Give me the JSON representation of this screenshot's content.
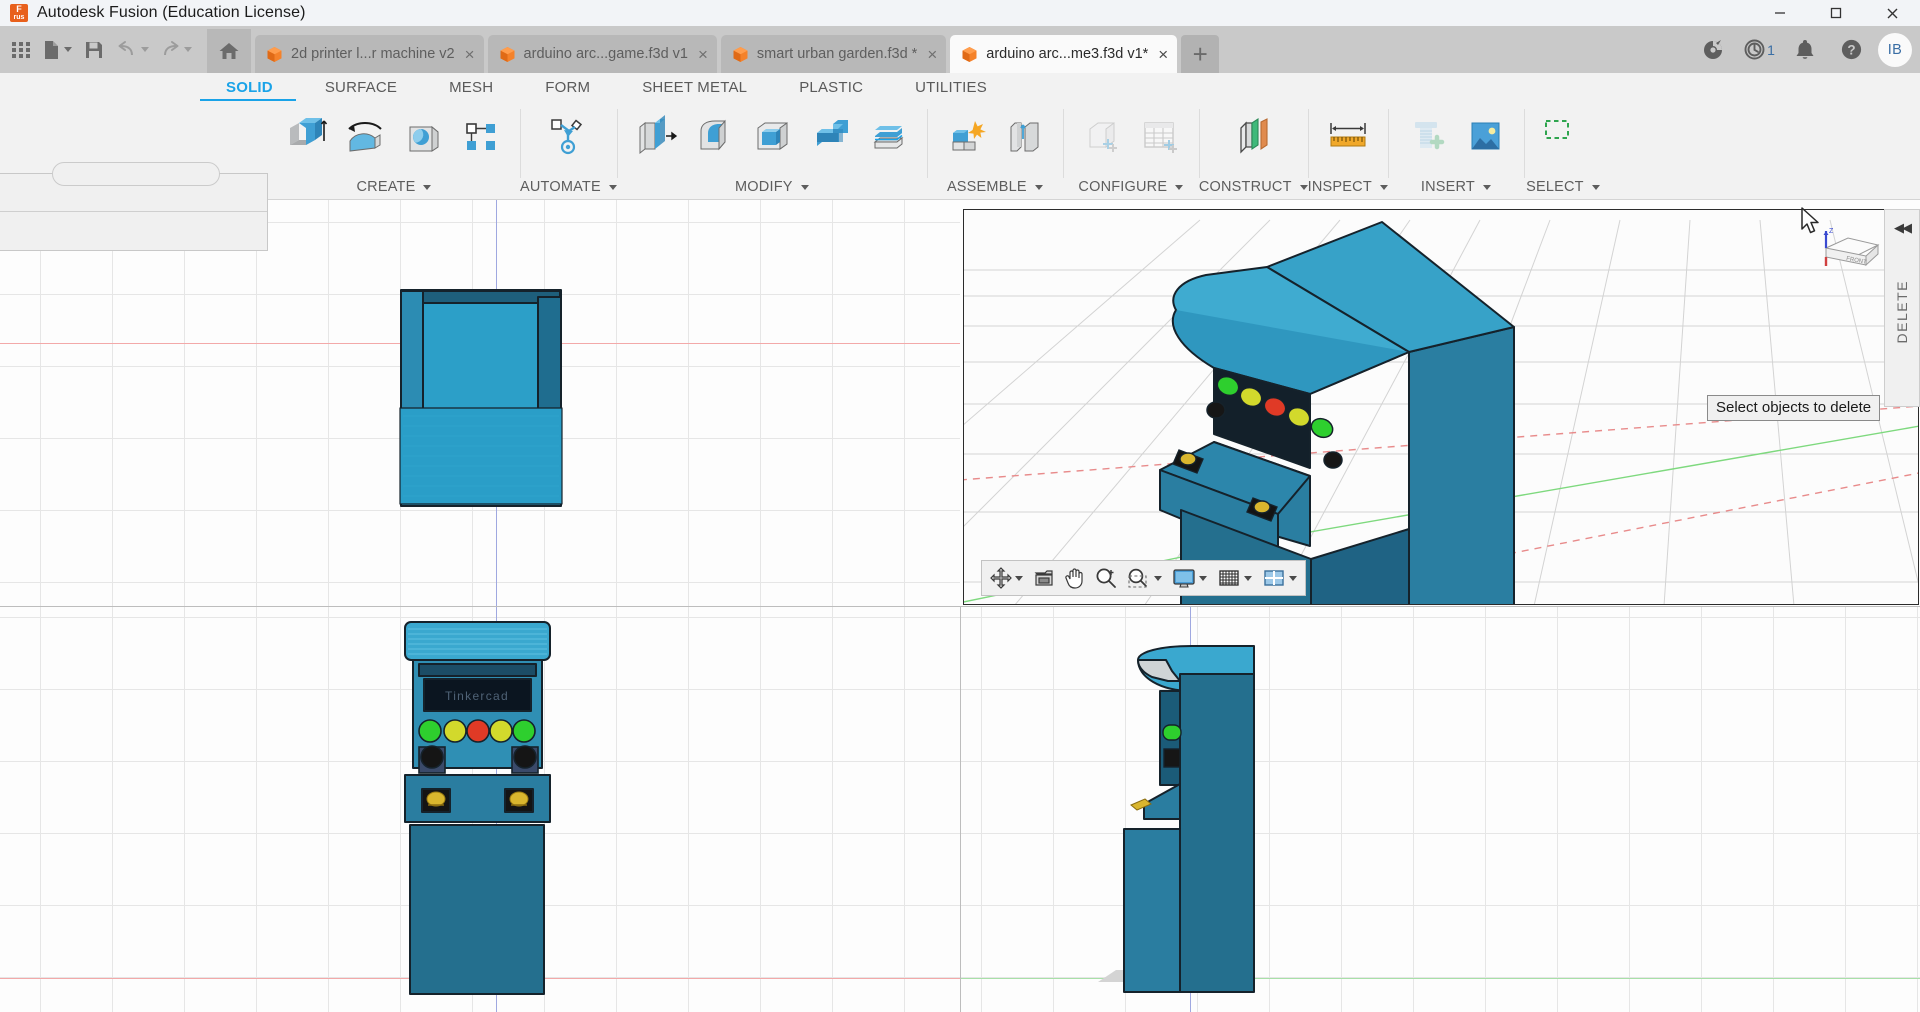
{
  "window": {
    "title": "Autodesk Fusion (Education License)",
    "logo_text": "F",
    "logo_sub": "rus",
    "minimize_icon": "minimize-icon",
    "maximize_icon": "maximize-icon",
    "close_icon": "close-icon"
  },
  "quick_access": {
    "grid_icon": "app-grid-icon",
    "new_icon": "new-document-icon",
    "save_icon": "save-icon",
    "undo_icon": "undo-icon",
    "redo_icon": "redo-icon",
    "home_icon": "home-icon"
  },
  "tabs": [
    {
      "label": "2d printer l...r machine v2",
      "active": false,
      "icon": "file-cube-icon",
      "close": "×"
    },
    {
      "label": "arduino arc...game.f3d v1",
      "active": false,
      "icon": "file-cube-icon",
      "close": "×"
    },
    {
      "label": "smart urban garden.f3d *",
      "active": false,
      "icon": "file-cube-icon",
      "close": "×"
    },
    {
      "label": "arduino arc...me3.f3d v1*",
      "active": true,
      "icon": "file-cube-icon",
      "close": "×"
    }
  ],
  "tab_actions": {
    "new_tab_label": "+",
    "extensions_icon": "extension-plug-icon",
    "jobs_icon": "job-status-clock-icon",
    "jobs_count": "1",
    "notifications_icon": "bell-icon",
    "help_icon": "help-icon",
    "account_initials": "IB"
  },
  "ribbon": {
    "tabs": [
      {
        "label": "SOLID",
        "active": true
      },
      {
        "label": "SURFACE",
        "active": false
      },
      {
        "label": "MESH",
        "active": false
      },
      {
        "label": "FORM",
        "active": false
      },
      {
        "label": "SHEET METAL",
        "active": false
      },
      {
        "label": "PLASTIC",
        "active": false
      },
      {
        "label": "UTILITIES",
        "active": false
      }
    ],
    "groups": [
      {
        "label": "CREATE",
        "has_caret": true,
        "icons": [
          "extrude-icon",
          "revolve-icon",
          "sweep-icon",
          "pattern-icon"
        ]
      },
      {
        "label": "AUTOMATE",
        "has_caret": true,
        "icons": [
          "automate-icon"
        ]
      },
      {
        "label": "MODIFY",
        "has_caret": true,
        "icons": [
          "press-pull-icon",
          "fillet-icon",
          "shell-icon",
          "combine-icon",
          "split-face-icon"
        ]
      },
      {
        "label": "ASSEMBLE",
        "has_caret": true,
        "icons": [
          "new-component-icon",
          "joint-icon"
        ]
      },
      {
        "label": "CONFIGURE",
        "has_caret": true,
        "icons": [
          "configure-cube-icon",
          "configure-table-icon"
        ]
      },
      {
        "label": "CONSTRUCT",
        "has_caret": true,
        "icons": [
          "offset-plane-icon"
        ]
      },
      {
        "label": "INSPECT",
        "has_caret": true,
        "icons": [
          "measure-icon"
        ]
      },
      {
        "label": "INSERT",
        "has_caret": true,
        "icons": [
          "insert-mcmaster-icon",
          "insert-image-icon"
        ]
      },
      {
        "label": "SELECT",
        "has_caret": true,
        "icons": [
          "select-window-icon"
        ]
      }
    ]
  },
  "viewport": {
    "tooltip": "Select objects to delete",
    "delete_panel": {
      "label": "DELETE",
      "collapse_icon": "collapse-left-arrows-icon",
      "collapse_glyph": "◀◀"
    },
    "viewcube_labels": {
      "top": "Z",
      "front": "FRONT"
    },
    "nav_toolbar": [
      {
        "icon": "orbit-icon",
        "has_caret": true
      },
      {
        "icon": "look-at-icon",
        "has_caret": false
      },
      {
        "icon": "pan-hand-icon",
        "has_caret": false
      },
      {
        "icon": "zoom-icon",
        "has_caret": false
      },
      {
        "icon": "fit-window-icon",
        "has_caret": true
      },
      {
        "icon": "display-settings-icon",
        "has_caret": true
      },
      {
        "icon": "grid-snaps-icon",
        "has_caret": true
      },
      {
        "icon": "viewports-icon",
        "has_caret": true
      }
    ],
    "cursor_icon": "mouse-pointer-icon"
  },
  "model": {
    "name": "arcade cabinet",
    "screen_text": "Tinkercad",
    "body_color": "#2c87ab",
    "body_dark": "#1f5f7d",
    "body_mid": "#2a7fa2",
    "top_color": "#37a7cf",
    "outline": "#15222b",
    "buttons": [
      "#35d435",
      "#d8df2a",
      "#e33a2a",
      "#d8df2a",
      "#35d435"
    ],
    "knob_color": "#1c1c1c",
    "joystick_color": "#d6b32c",
    "screen_color": "#0c1722",
    "views": [
      {
        "name": "top-view",
        "position": "top-left"
      },
      {
        "name": "perspective-view",
        "position": "top-right"
      },
      {
        "name": "front-view",
        "position": "bottom-left"
      },
      {
        "name": "right-view",
        "position": "bottom-right"
      }
    ]
  }
}
